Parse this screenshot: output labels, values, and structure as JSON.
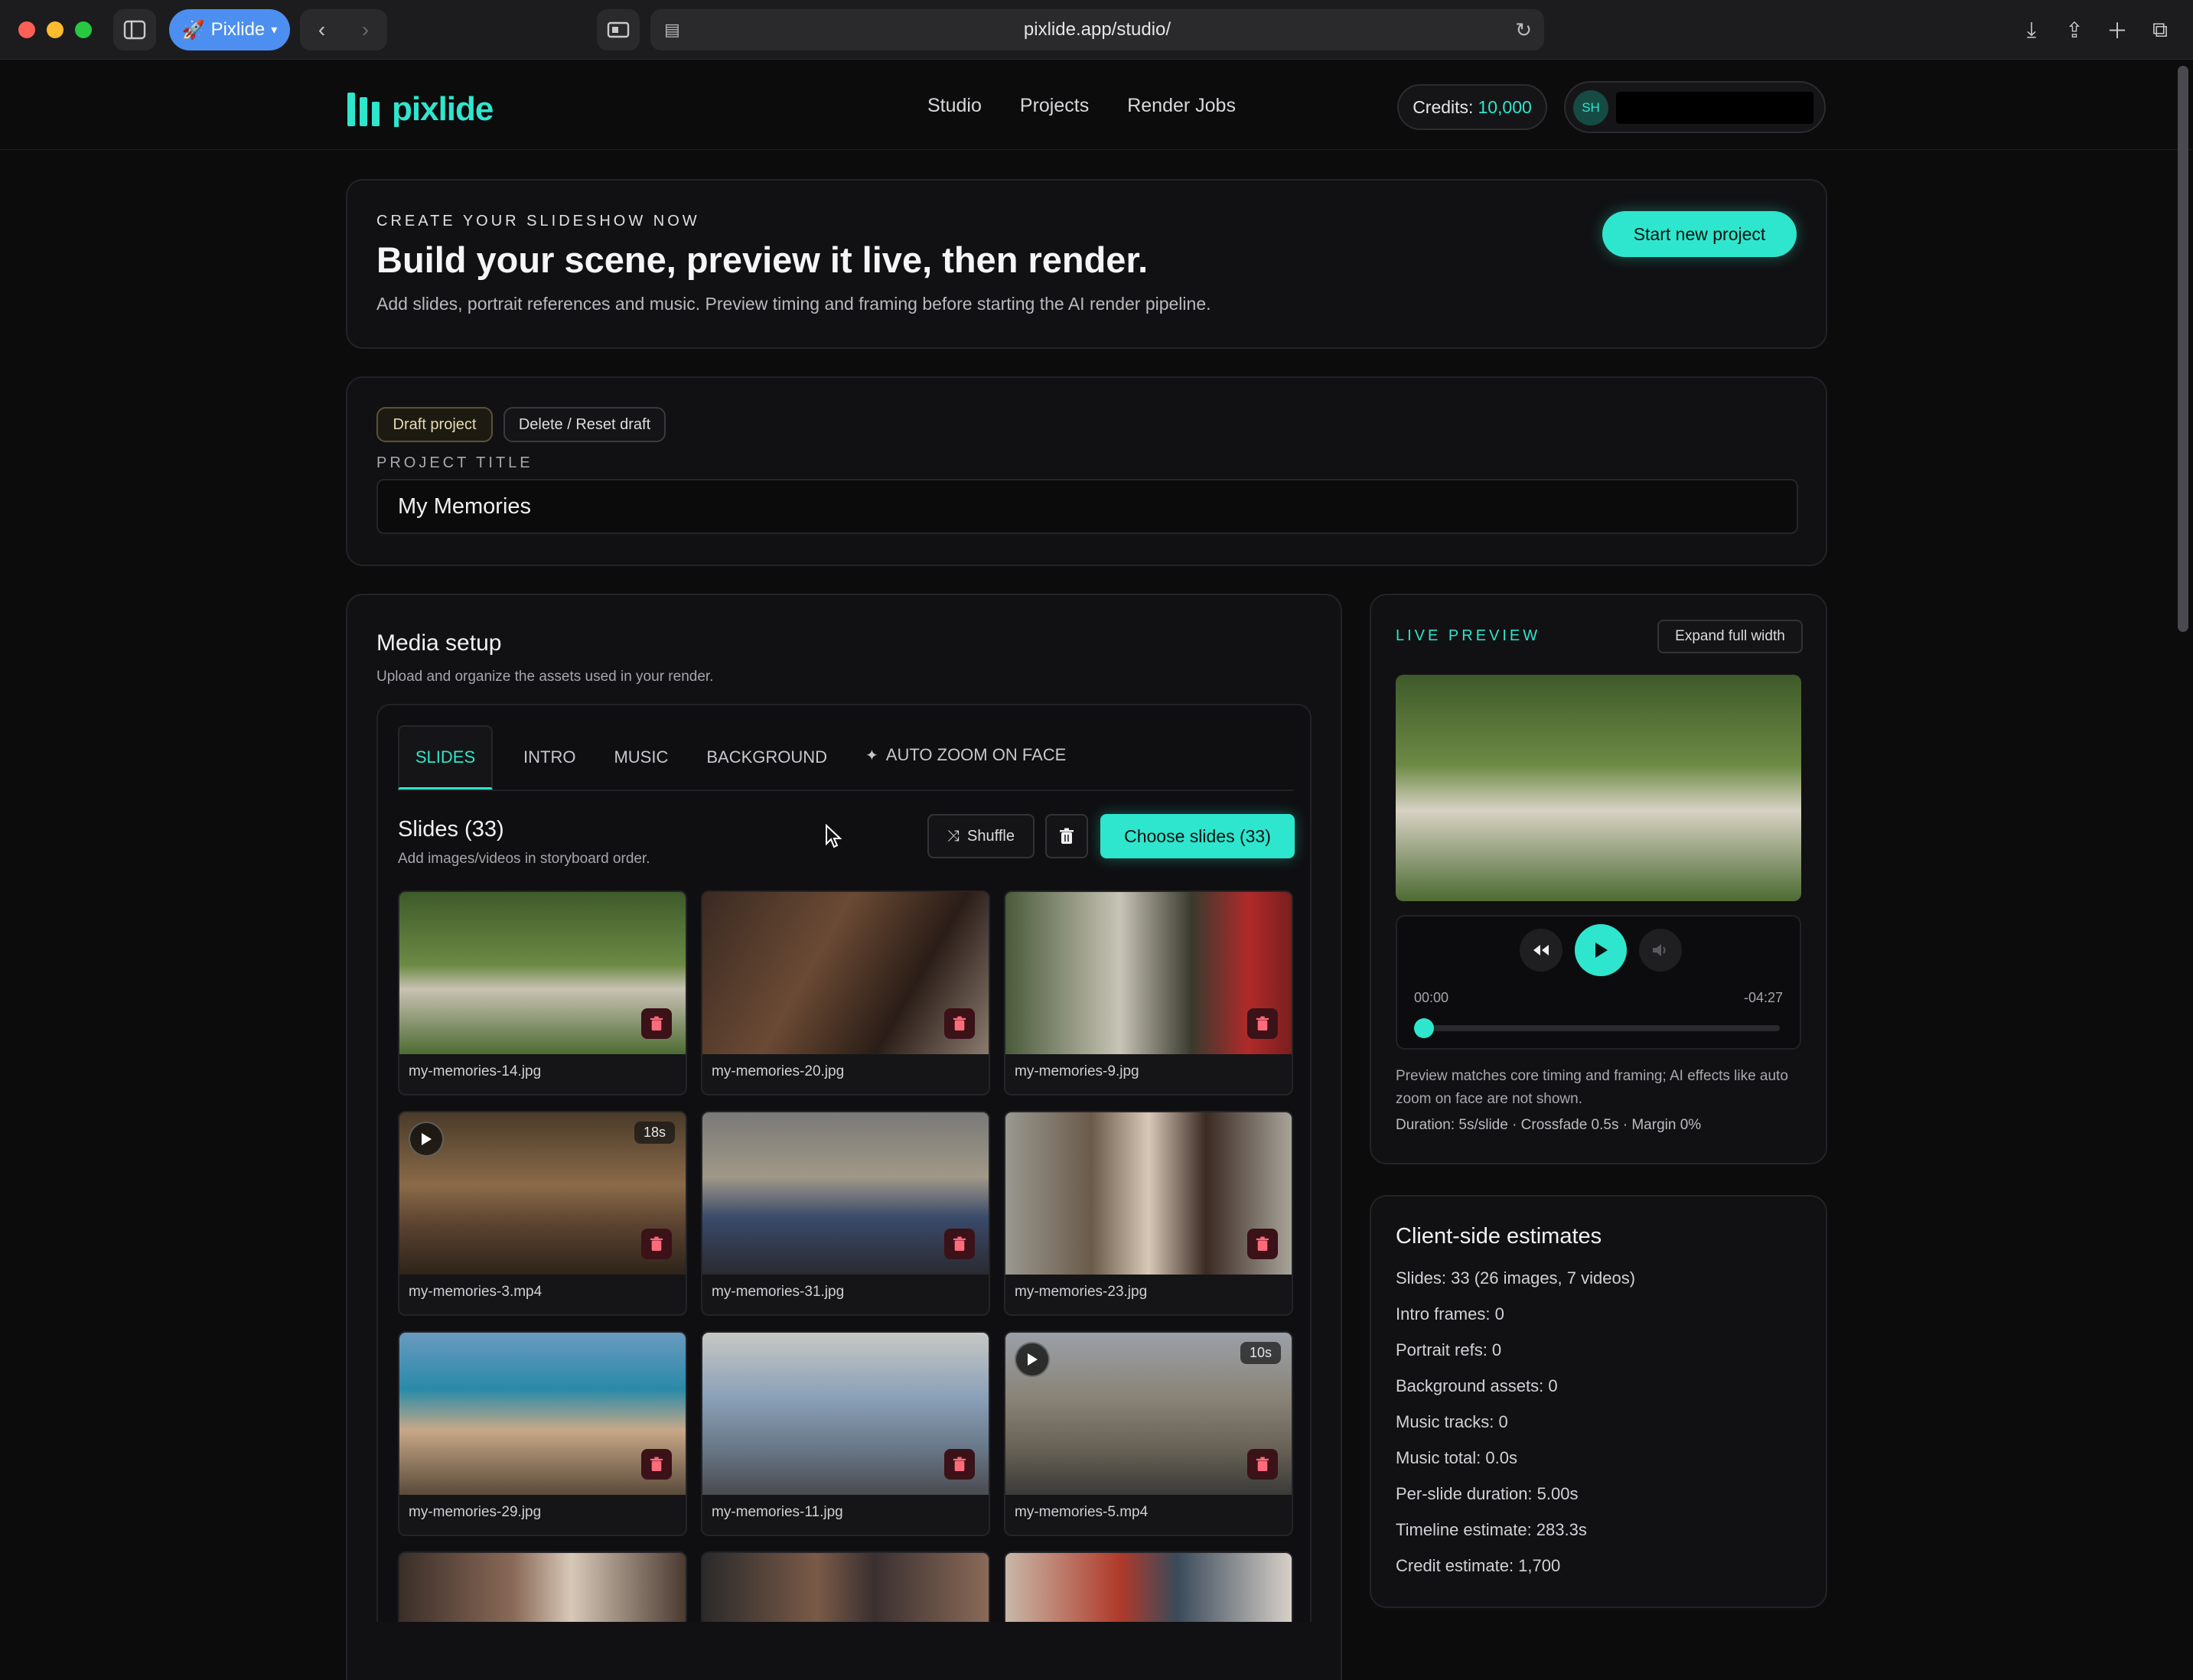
{
  "browser": {
    "tab_label": "Pixlide",
    "url": "pixlide.app/studio/"
  },
  "header": {
    "logo": "pixlide",
    "nav": [
      "Studio",
      "Projects",
      "Render Jobs"
    ],
    "credits_label": "Credits:",
    "credits_value": "10,000",
    "avatar_initials": "SH"
  },
  "hero": {
    "eyebrow": "CREATE YOUR SLIDESHOW NOW",
    "title": "Build your scene, preview it live, then render.",
    "subtitle": "Add slides, portrait references and music. Preview timing and framing before starting the AI render pipeline.",
    "cta": "Start new project"
  },
  "project": {
    "status_badge": "Draft project",
    "delete_label": "Delete / Reset draft",
    "title_label": "PROJECT TITLE",
    "title_value": "My Memories"
  },
  "media": {
    "title": "Media setup",
    "subtitle": "Upload and organize the assets used in your render.",
    "tabs": [
      "SLIDES",
      "INTRO",
      "MUSIC",
      "BACKGROUND",
      "AUTO ZOOM ON FACE"
    ],
    "slides_heading": "Slides (33)",
    "slides_sub": "Add images/videos in storyboard order.",
    "shuffle_label": "Shuffle",
    "choose_label": "Choose slides (33)",
    "tiles": [
      {
        "name": "my-memories-14.jpg",
        "video": false,
        "duration": ""
      },
      {
        "name": "my-memories-20.jpg",
        "video": false,
        "duration": ""
      },
      {
        "name": "my-memories-9.jpg",
        "video": false,
        "duration": ""
      },
      {
        "name": "my-memories-3.mp4",
        "video": true,
        "duration": "18s"
      },
      {
        "name": "my-memories-31.jpg",
        "video": false,
        "duration": ""
      },
      {
        "name": "my-memories-23.jpg",
        "video": false,
        "duration": ""
      },
      {
        "name": "my-memories-29.jpg",
        "video": false,
        "duration": ""
      },
      {
        "name": "my-memories-11.jpg",
        "video": false,
        "duration": ""
      },
      {
        "name": "my-memories-5.mp4",
        "video": true,
        "duration": "10s"
      }
    ]
  },
  "preview": {
    "label": "LIVE PREVIEW",
    "expand_label": "Expand full width",
    "time_start": "00:00",
    "time_end": "-04:27",
    "progress": 0,
    "note": "Preview matches core timing and framing; AI effects like auto zoom on face are not shown.",
    "meta": "Duration: 5s/slide · Crossfade 0.5s · Margin 0%"
  },
  "estimates": {
    "title": "Client-side estimates",
    "rows": [
      "Slides: 33 (26 images, 7 videos)",
      "Intro frames: 0",
      "Portrait refs: 0",
      "Background assets: 0",
      "Music tracks: 0",
      "Music total: 0.0s",
      "Per-slide duration: 5.00s",
      "Timeline estimate: 283.3s",
      "Credit estimate: 1,700"
    ]
  },
  "colors": {
    "accent": "#2ee6cd",
    "background": "#0c0c0d",
    "card": "#111113"
  }
}
